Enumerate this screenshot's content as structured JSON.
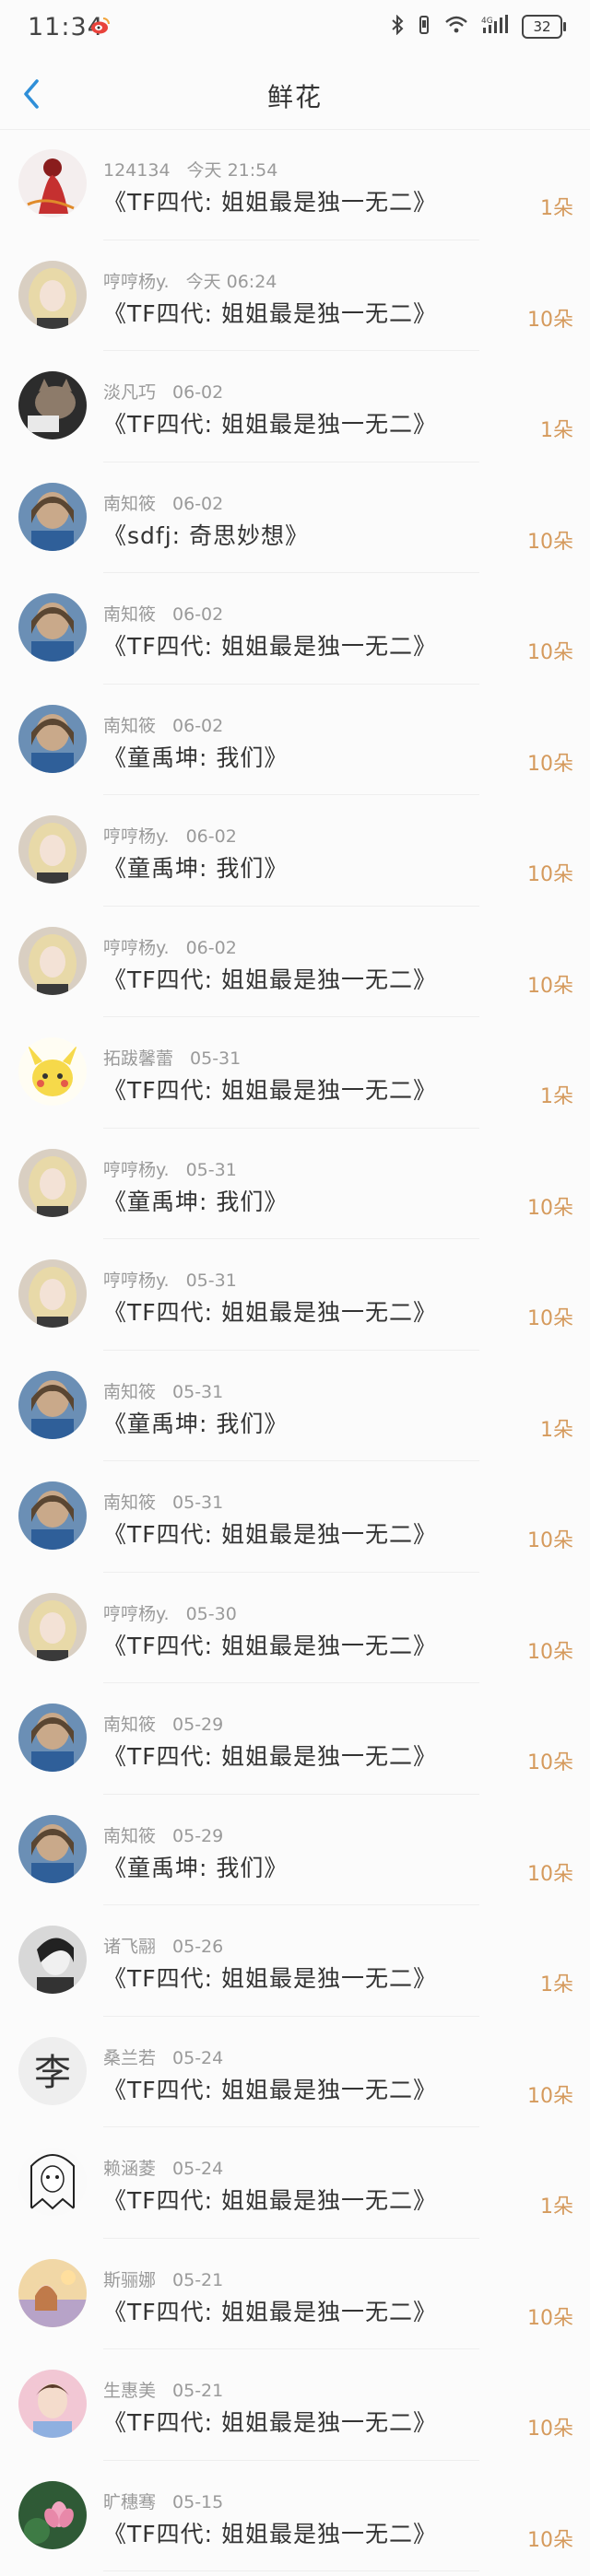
{
  "status": {
    "time": "11:34",
    "battery": "32"
  },
  "header": {
    "title": "鲜花"
  },
  "colors": {
    "accent": "#2f8fd8",
    "count": "#d59a5c"
  },
  "rows": [
    {
      "user": "124134",
      "date": "今天 21:54",
      "book": "《TF四代: 姐姐最是独一无二》",
      "count": "1朵"
    },
    {
      "user": "哼哼杨y.",
      "date": "今天 06:24",
      "book": "《TF四代: 姐姐最是独一无二》",
      "count": "10朵"
    },
    {
      "user": "淡凡巧",
      "date": "06-02",
      "book": "《TF四代: 姐姐最是独一无二》",
      "count": "1朵"
    },
    {
      "user": "南知筱",
      "date": "06-02",
      "book": "《sdfj: 奇思妙想》",
      "count": "10朵"
    },
    {
      "user": "南知筱",
      "date": "06-02",
      "book": "《TF四代: 姐姐最是独一无二》",
      "count": "10朵"
    },
    {
      "user": "南知筱",
      "date": "06-02",
      "book": "《童禹坤: 我们》",
      "count": "10朵"
    },
    {
      "user": "哼哼杨y.",
      "date": "06-02",
      "book": "《童禹坤: 我们》",
      "count": "10朵"
    },
    {
      "user": "哼哼杨y.",
      "date": "06-02",
      "book": "《TF四代: 姐姐最是独一无二》",
      "count": "10朵"
    },
    {
      "user": "拓跋馨蕾",
      "date": "05-31",
      "book": "《TF四代: 姐姐最是独一无二》",
      "count": "1朵"
    },
    {
      "user": "哼哼杨y.",
      "date": "05-31",
      "book": "《童禹坤: 我们》",
      "count": "10朵"
    },
    {
      "user": "哼哼杨y.",
      "date": "05-31",
      "book": "《TF四代: 姐姐最是独一无二》",
      "count": "10朵"
    },
    {
      "user": "南知筱",
      "date": "05-31",
      "book": "《童禹坤: 我们》",
      "count": "1朵"
    },
    {
      "user": "南知筱",
      "date": "05-31",
      "book": "《TF四代: 姐姐最是独一无二》",
      "count": "10朵"
    },
    {
      "user": "哼哼杨y.",
      "date": "05-30",
      "book": "《TF四代: 姐姐最是独一无二》",
      "count": "10朵"
    },
    {
      "user": "南知筱",
      "date": "05-29",
      "book": "《TF四代: 姐姐最是独一无二》",
      "count": "10朵"
    },
    {
      "user": "南知筱",
      "date": "05-29",
      "book": "《童禹坤: 我们》",
      "count": "10朵"
    },
    {
      "user": "诸飞翮",
      "date": "05-26",
      "book": "《TF四代: 姐姐最是独一无二》",
      "count": "1朵"
    },
    {
      "user": "桑兰若",
      "date": "05-24",
      "book": "《TF四代: 姐姐最是独一无二》",
      "count": "10朵"
    },
    {
      "user": "赖涵菱",
      "date": "05-24",
      "book": "《TF四代: 姐姐最是独一无二》",
      "count": "1朵"
    },
    {
      "user": "斯骊娜",
      "date": "05-21",
      "book": "《TF四代: 姐姐最是独一无二》",
      "count": "10朵"
    },
    {
      "user": "生惠美",
      "date": "05-21",
      "book": "《TF四代: 姐姐最是独一无二》",
      "count": "10朵"
    },
    {
      "user": "旷穗骞",
      "date": "05-15",
      "book": "《TF四代: 姐姐最是独一无二》",
      "count": "10朵"
    }
  ],
  "avatars": [
    "red-figure",
    "blonde-girl",
    "cat-photo",
    "blue-portrait",
    "blue-portrait",
    "blue-portrait",
    "blonde-girl",
    "blonde-girl",
    "pikachu",
    "blonde-girl",
    "blonde-girl",
    "blue-portrait",
    "blue-portrait",
    "blonde-girl",
    "blue-portrait",
    "blue-portrait",
    "bw-portrait",
    "li-character",
    "anime-sketch",
    "sunset-girl",
    "pink-boy",
    "lotus-green"
  ]
}
